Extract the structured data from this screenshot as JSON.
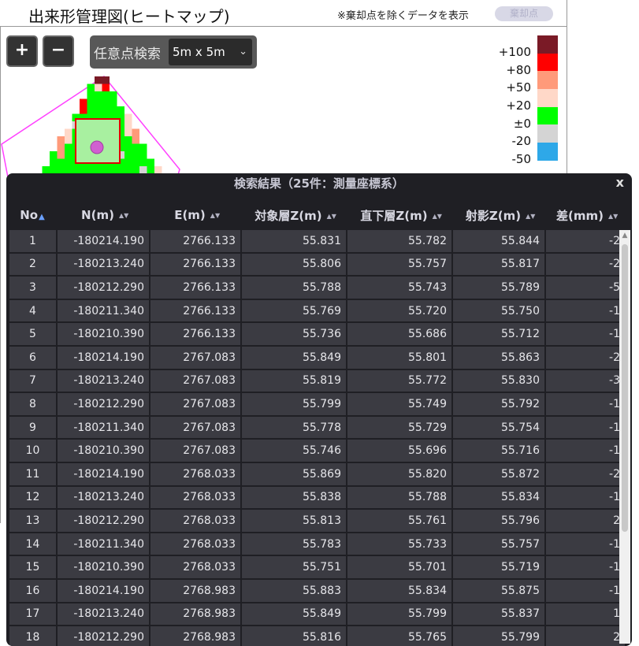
{
  "header": {
    "title": "出来形管理図(ヒートマップ)",
    "note": "※棄却点を除くデータを表示",
    "toggle_label": "棄却点"
  },
  "toolbar": {
    "zoom_in_label": "+",
    "zoom_out_label": "−",
    "search_label": "任意点検索",
    "grid_select_value": "5m x 5m"
  },
  "legend": {
    "labels": [
      "+100",
      "+80",
      "+50",
      "+20",
      "±0",
      "-20",
      "-50"
    ],
    "colors": [
      "#7a1a26",
      "#ff0000",
      "#ff9a7a",
      "#ffd8c8",
      "#00ff00",
      "#d4d4d4",
      "#2ea8e8"
    ]
  },
  "results": {
    "title": "検索結果（25件：測量座標系）",
    "close_label": "x",
    "columns": [
      "No",
      "N(m)",
      "E(m)",
      "対象層Z(m)",
      "直下層Z(m)",
      "射影Z(m)",
      "差(mm)"
    ],
    "rows": [
      [
        "1",
        "-180214.190",
        "2766.133",
        "55.831",
        "55.782",
        "55.844",
        "-2"
      ],
      [
        "2",
        "-180213.240",
        "2766.133",
        "55.806",
        "55.757",
        "55.817",
        "-2"
      ],
      [
        "3",
        "-180212.290",
        "2766.133",
        "55.788",
        "55.743",
        "55.789",
        "-5"
      ],
      [
        "4",
        "-180211.340",
        "2766.133",
        "55.769",
        "55.720",
        "55.750",
        "-1"
      ],
      [
        "5",
        "-180210.390",
        "2766.133",
        "55.736",
        "55.686",
        "55.712",
        "-1"
      ],
      [
        "6",
        "-180214.190",
        "2767.083",
        "55.849",
        "55.801",
        "55.863",
        "-2"
      ],
      [
        "7",
        "-180213.240",
        "2767.083",
        "55.819",
        "55.772",
        "55.830",
        "-3"
      ],
      [
        "8",
        "-180212.290",
        "2767.083",
        "55.799",
        "55.749",
        "55.792",
        "-1"
      ],
      [
        "9",
        "-180211.340",
        "2767.083",
        "55.778",
        "55.729",
        "55.754",
        "-1"
      ],
      [
        "10",
        "-180210.390",
        "2767.083",
        "55.746",
        "55.696",
        "55.716",
        "-1"
      ],
      [
        "11",
        "-180214.190",
        "2768.033",
        "55.869",
        "55.820",
        "55.872",
        "-2"
      ],
      [
        "12",
        "-180213.240",
        "2768.033",
        "55.838",
        "55.788",
        "55.834",
        "-1"
      ],
      [
        "13",
        "-180212.290",
        "2768.033",
        "55.813",
        "55.761",
        "55.796",
        "2"
      ],
      [
        "14",
        "-180211.340",
        "2768.033",
        "55.783",
        "55.733",
        "55.757",
        "-1"
      ],
      [
        "15",
        "-180210.390",
        "2768.033",
        "55.751",
        "55.701",
        "55.719",
        "-1"
      ],
      [
        "16",
        "-180214.190",
        "2768.983",
        "55.883",
        "55.834",
        "55.875",
        "-1"
      ],
      [
        "17",
        "-180213.240",
        "2768.983",
        "55.849",
        "55.799",
        "55.837",
        "1"
      ],
      [
        "18",
        "-180212.290",
        "2768.983",
        "55.816",
        "55.765",
        "55.799",
        "2"
      ]
    ]
  }
}
